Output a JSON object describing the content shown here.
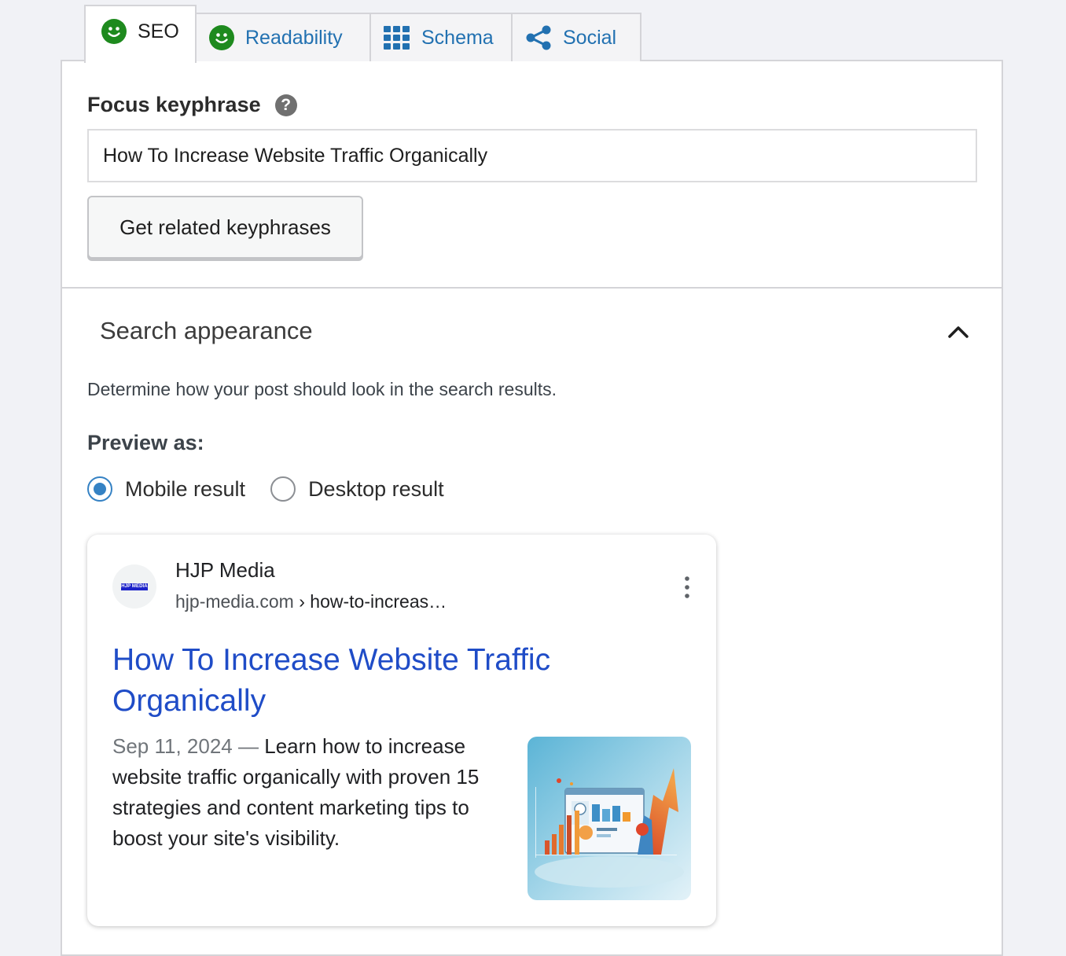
{
  "tabs": {
    "seo": "SEO",
    "readability": "Readability",
    "schema": "Schema",
    "social": "Social"
  },
  "focus_keyphrase": {
    "label": "Focus keyphrase",
    "help": "?",
    "value": "How To Increase Website Traffic Organically",
    "related_button": "Get related keyphrases"
  },
  "search_appearance": {
    "title": "Search appearance",
    "description": "Determine how your post should look in the search results.",
    "preview_label": "Preview as:",
    "options": [
      "Mobile result",
      "Desktop result"
    ],
    "selected": "Mobile result"
  },
  "google_preview": {
    "favicon_text": "HJP MEDIA",
    "site_name": "HJP Media",
    "domain": "hjp-media.com",
    "path": "› how-to-increas…",
    "title": "How To Increase Website Traffic Organically",
    "date": "Sep 11, 2024",
    "separator": "—",
    "description": "Learn how to increase website traffic organically with proven 15 strategies and content marketing tips to boost your site's visibility."
  },
  "colors": {
    "accent": "#2271b1",
    "smiley_green": "#1e8a1e",
    "link_blue": "#1f4cc7",
    "radio_blue": "#3582c4"
  },
  "icons": [
    "smiley-good-icon",
    "grid-icon",
    "share-icon",
    "help-icon",
    "chevron-up-icon",
    "kebab-menu-icon"
  ]
}
